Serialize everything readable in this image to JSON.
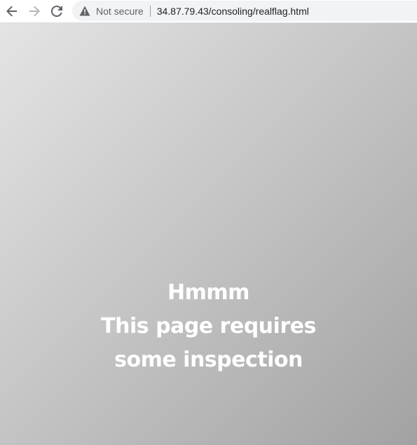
{
  "browser": {
    "back_icon": "arrow-left-icon",
    "forward_icon": "arrow-right-icon",
    "reload_icon": "reload-icon",
    "security_icon": "warning-triangle-icon",
    "security_label": "Not secure",
    "url": "34.87.79.43/consoling/realflag.html"
  },
  "page": {
    "lines": [
      "Hmmm",
      "This page requires",
      "some inspection"
    ],
    "text_color": "#ffffff",
    "background_gradient": [
      "#e4e4e4",
      "#a2a2a2"
    ]
  }
}
